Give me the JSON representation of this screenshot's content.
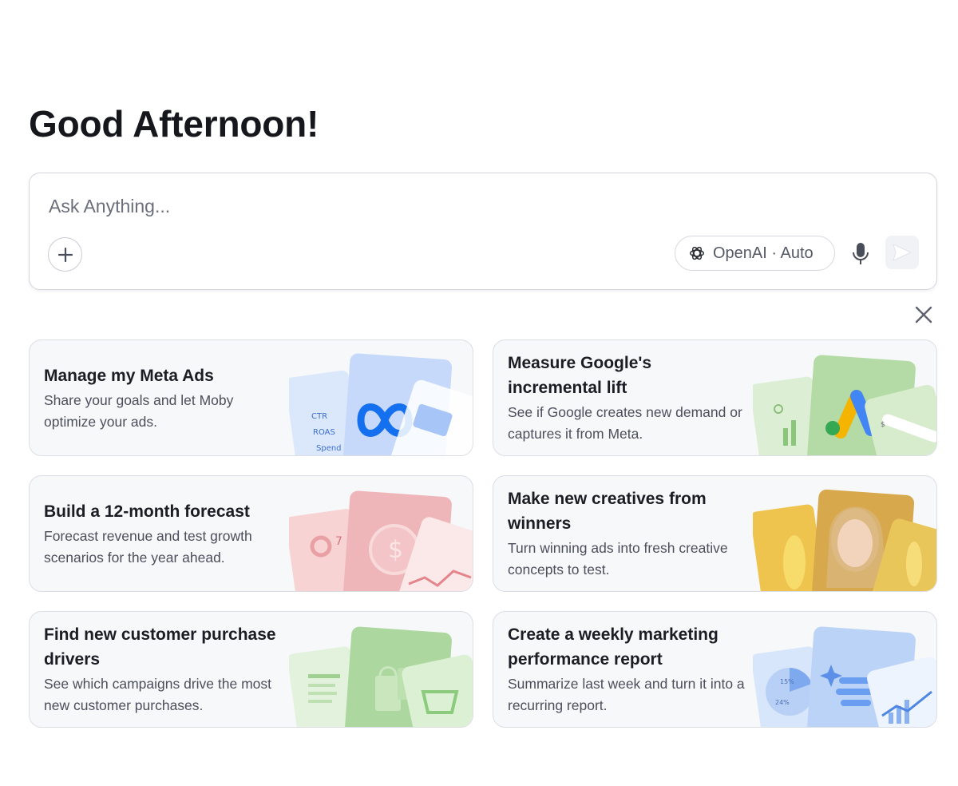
{
  "greeting": "Good Afternoon!",
  "composer": {
    "placeholder": "Ask Anything...",
    "model_label": "OpenAI · Auto",
    "add_icon": "plus-icon",
    "mic_icon": "microphone-icon",
    "send_icon": "send-icon"
  },
  "suggestions": [
    {
      "title": "Manage my Meta Ads",
      "desc": "Share your goals and let Moby optimize your ads.",
      "art_labels": [
        "CTR",
        "ROAS",
        "Spend"
      ],
      "accent": "#3b82f6"
    },
    {
      "title": "Measure Google's incremental lift",
      "desc": "See if Google creates new demand or captures it from Meta.",
      "art_labels": [
        "$"
      ],
      "accent": "#8bc77a"
    },
    {
      "title": "Build a 12-month forecast",
      "desc": "Forecast revenue and test growth scenarios for the year ahead.",
      "art_labels": [
        "7"
      ],
      "accent": "#e99aa2"
    },
    {
      "title": "Make new creatives from winners",
      "desc": "Turn winning ads into fresh creative concepts to test.",
      "accent": "#e8c254"
    },
    {
      "title": "Find new customer purchase drivers",
      "desc": "See which campaigns drive the most new customer purchases.",
      "accent": "#8fcf86"
    },
    {
      "title": "Create a weekly marketing performance report",
      "desc": "Summarize last week and turn it into a recurring report.",
      "art_labels": [
        "15%",
        "24%"
      ],
      "accent": "#6ea4f2"
    }
  ]
}
